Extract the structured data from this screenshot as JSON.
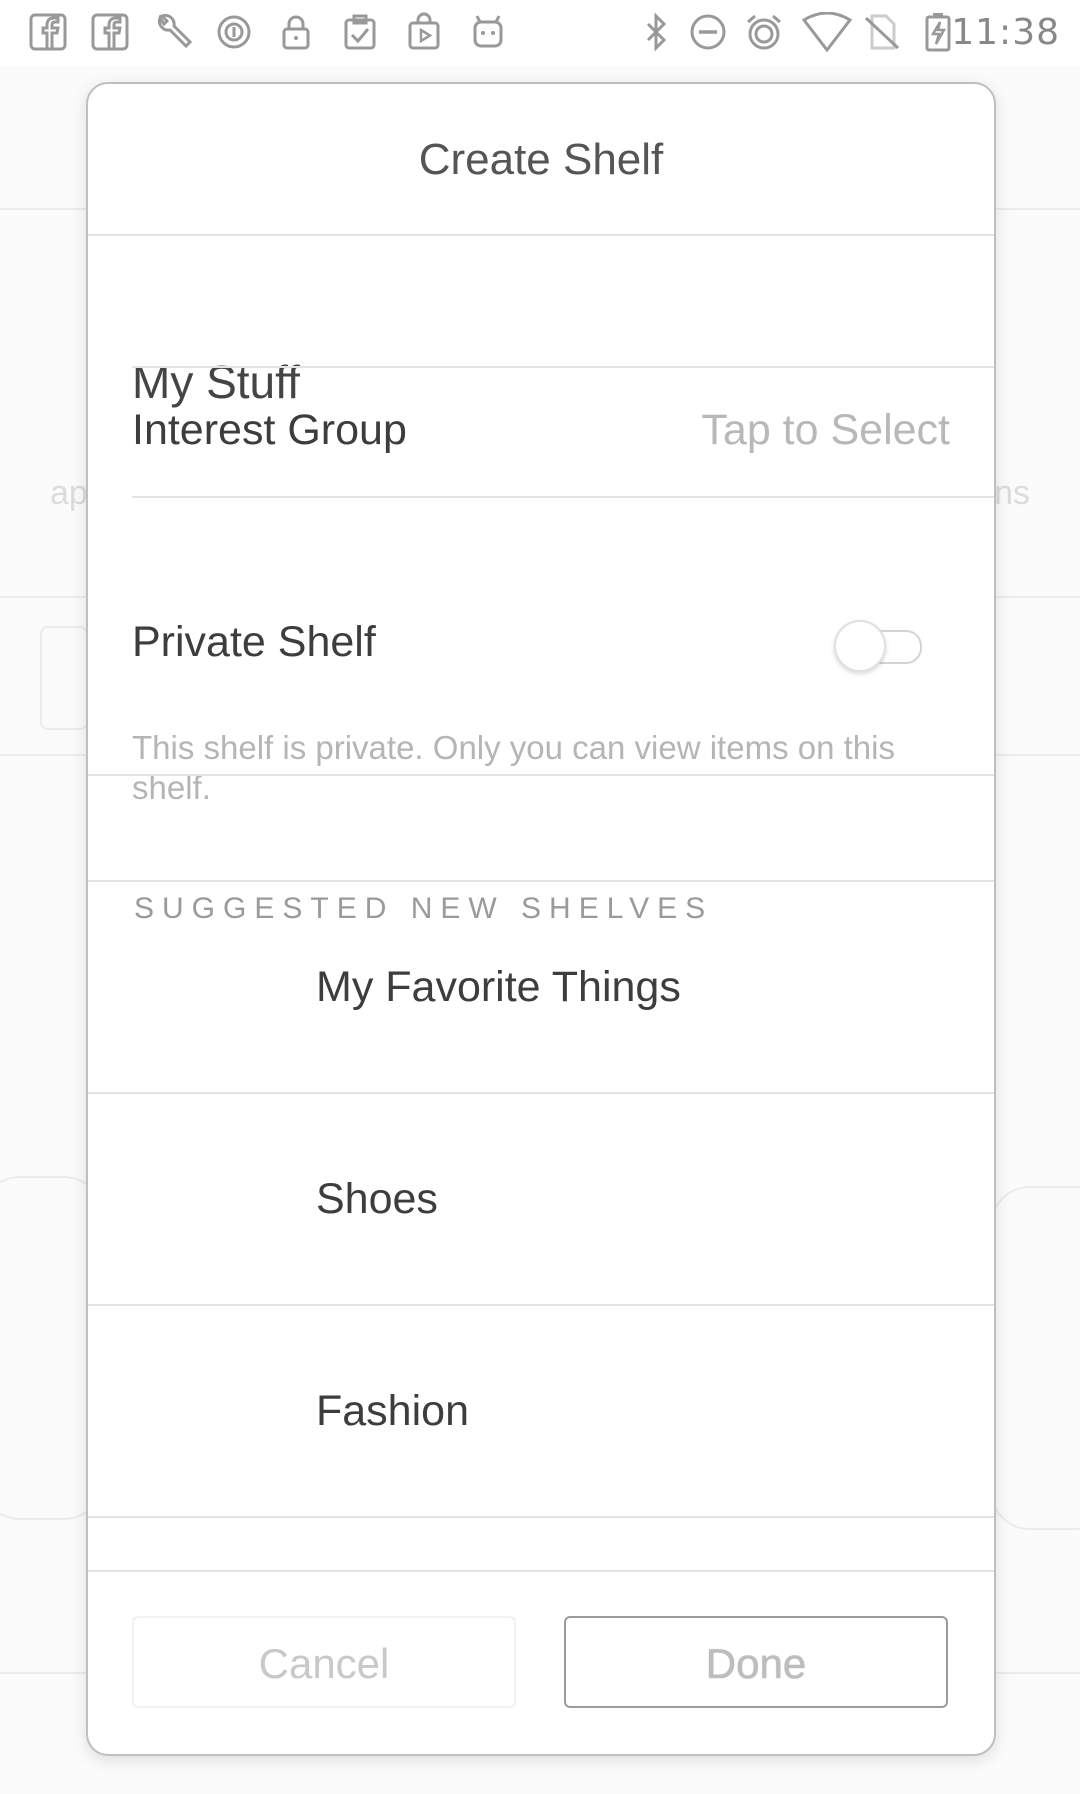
{
  "status_bar": {
    "time": "11:38",
    "left_icons": [
      "facebook-icon",
      "facebook-icon",
      "wrench-icon",
      "circle-i-icon",
      "lock-icon",
      "clipboard-check-icon",
      "play-bag-icon",
      "android-icon"
    ],
    "right_icons": [
      "bluetooth-icon",
      "do-not-disturb-icon",
      "alarm-icon",
      "wifi-icon",
      "no-sim-icon",
      "battery-charging-icon"
    ]
  },
  "background": {
    "left_partial_text": "ap",
    "right_partial_text": "ns"
  },
  "dialog": {
    "title": "Create Shelf",
    "name_input": {
      "value": "My Stuff",
      "placeholder": ""
    },
    "interest_group": {
      "label": "Interest Group",
      "value": "Tap to Select"
    },
    "private_shelf": {
      "label": "Private Shelf",
      "enabled": false,
      "note": "This shelf is private. Only you can view items on this shelf."
    },
    "suggested_header": "SUGGESTED NEW SHELVES",
    "suggestions": [
      {
        "label": "My Favorite Things"
      },
      {
        "label": "Shoes"
      },
      {
        "label": "Fashion"
      }
    ],
    "buttons": {
      "cancel": "Cancel",
      "done": "Done"
    }
  },
  "colors": {
    "dialog_border": "#bfbfbf",
    "divider": "#e3e3e3",
    "primary_text": "#3d3d3d",
    "secondary_text": "#b8b8b8"
  }
}
